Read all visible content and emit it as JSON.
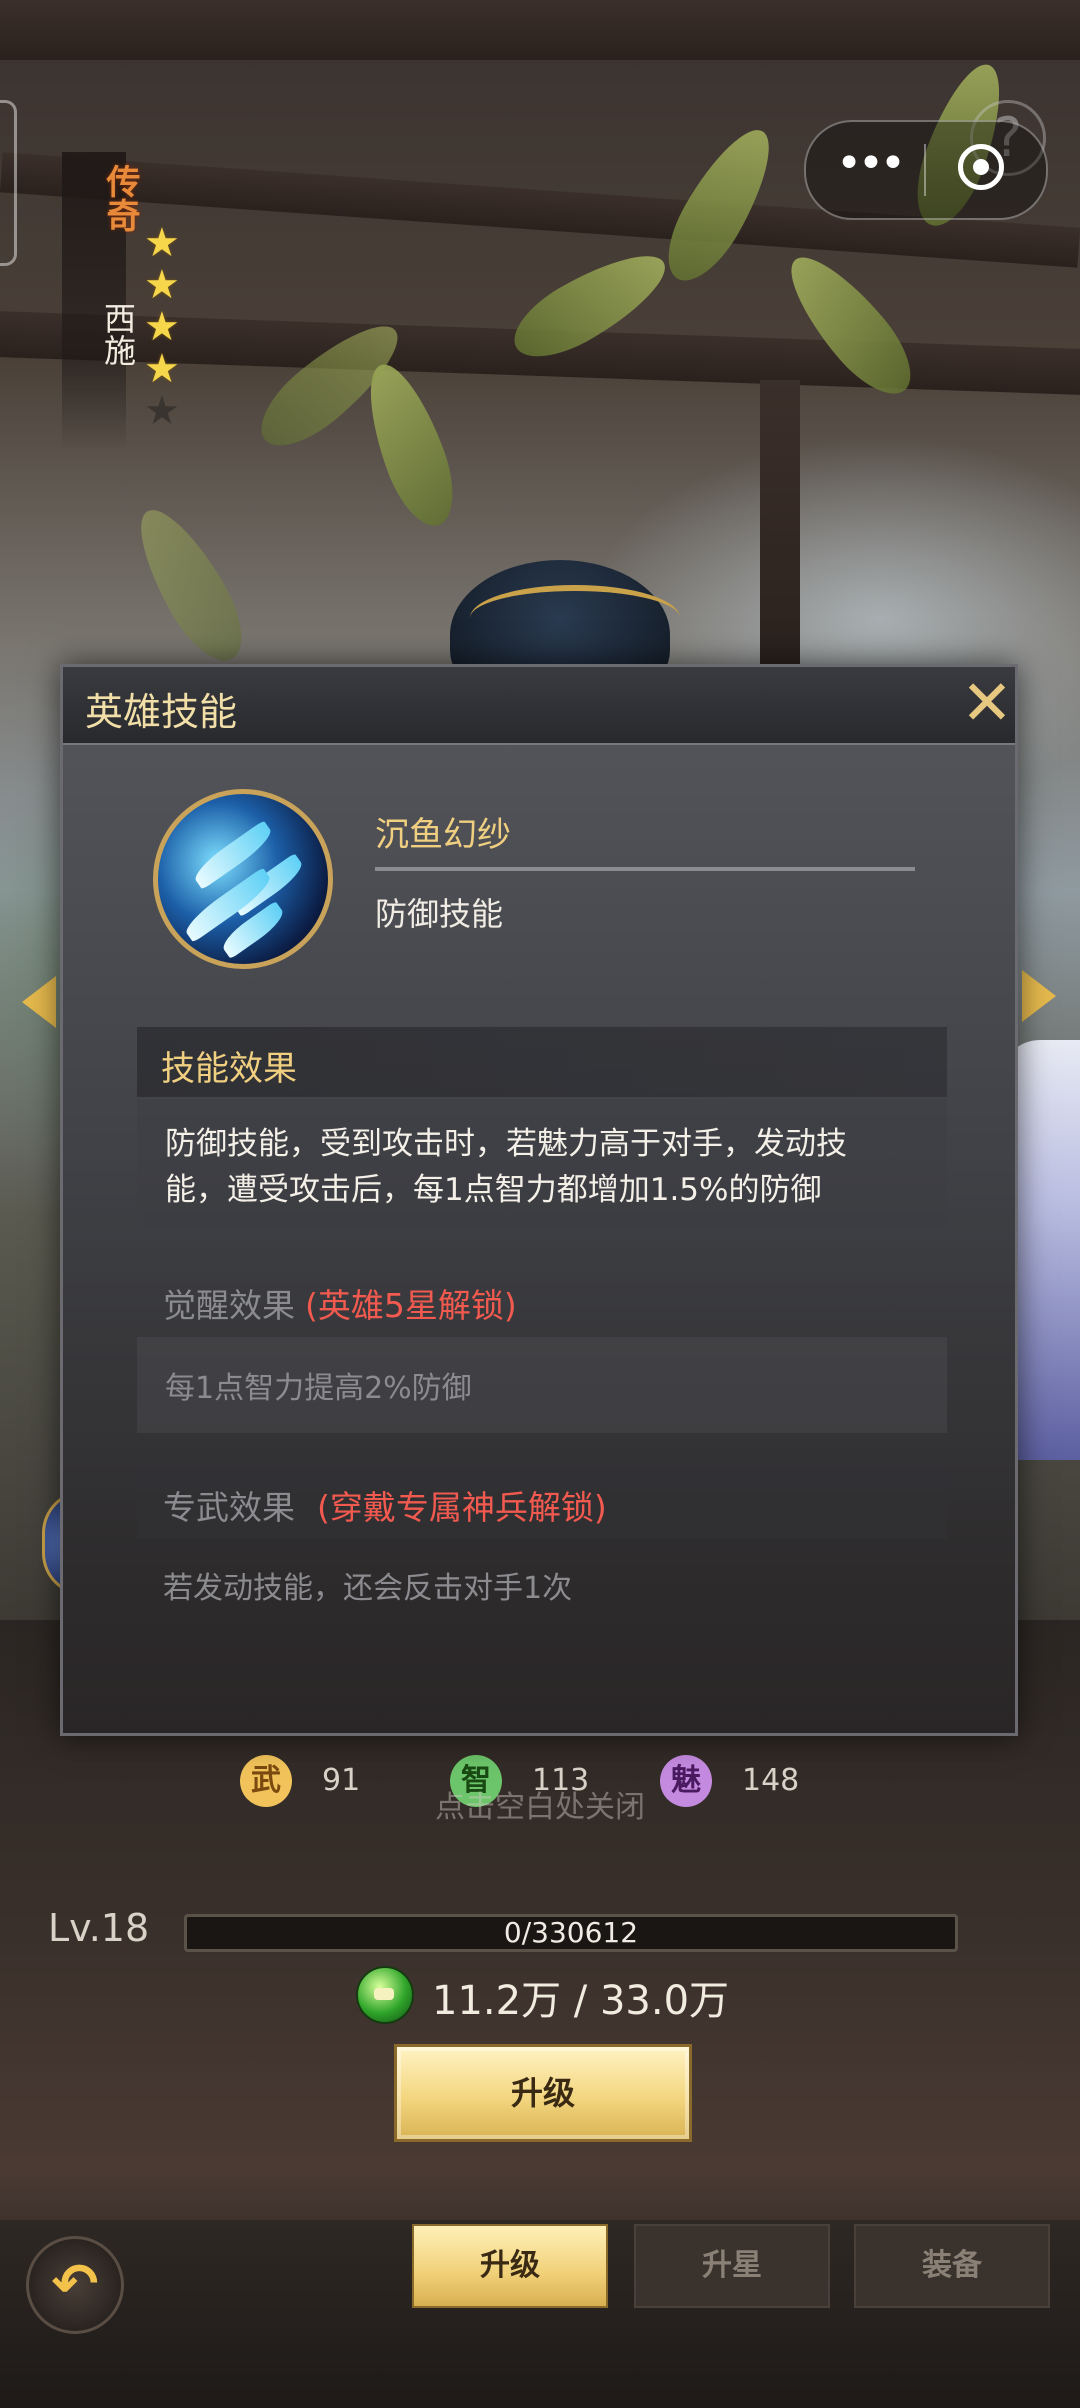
{
  "hero": {
    "rarity": "传奇",
    "name": "西施",
    "stars_filled": 4,
    "stars_total": 5
  },
  "capsule": {
    "more_label": "•••",
    "help_label": "?"
  },
  "modal": {
    "title": "英雄技能",
    "close_label": "✕",
    "skill": {
      "name": "沉鱼幻纱",
      "type": "防御技能"
    },
    "effect": {
      "title": "技能效果",
      "text": "防御技能，受到攻击时，若魅力高于对手，发动技能，遭受攻击后，每1点智力都增加1.5%的防御"
    },
    "awakening": {
      "title": "觉醒效果",
      "lock": "(英雄5星解锁)",
      "text": "每1点智力提高2%防御"
    },
    "exclusive_weapon": {
      "title": "专武效果",
      "lock": "(穿戴专属神兵解锁)",
      "text": "若发动技能，还会反击对手1次"
    }
  },
  "stats": [
    {
      "label": "武",
      "value": "91",
      "color": "#f1c35a"
    },
    {
      "label": "智",
      "value": "113",
      "color": "#6cc56a"
    },
    {
      "label": "魅",
      "value": "148",
      "color": "#c48ae0"
    }
  ],
  "close_hint": "点击空白处关闭",
  "level": {
    "label": "Lv.18",
    "xp_text": "0/330612",
    "xp_progress": 0
  },
  "cost": {
    "text": "11.2万 / 33.0万"
  },
  "upgrade_button": "升级",
  "tabs": [
    {
      "label": "升级",
      "active": true
    },
    {
      "label": "升星",
      "active": false
    },
    {
      "label": "装备",
      "active": false
    }
  ],
  "back_label": "↶"
}
